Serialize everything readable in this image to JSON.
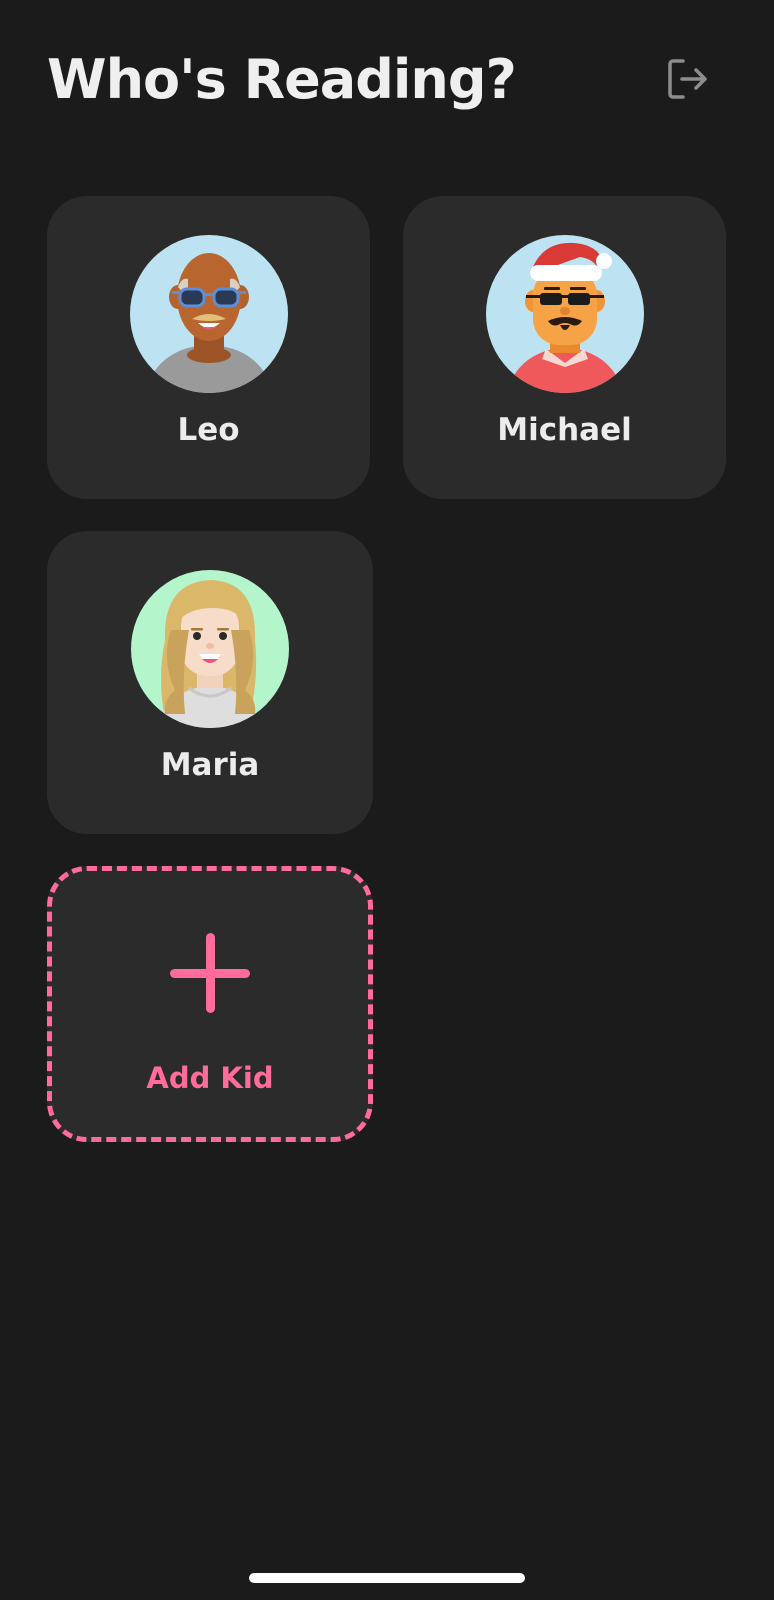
{
  "header": {
    "title": "Who's Reading?",
    "logout_icon": "logout-icon"
  },
  "profiles": [
    {
      "name": "Leo",
      "avatar_icon": "avatar-leo",
      "avatar_bg": "#bde3f3"
    },
    {
      "name": "Michael",
      "avatar_icon": "avatar-michael",
      "avatar_bg": "#bde3f3"
    },
    {
      "name": "Maria",
      "avatar_icon": "avatar-maria",
      "avatar_bg": "#b5f5cc"
    }
  ],
  "add_kid": {
    "label": "Add Kid",
    "icon": "plus-icon"
  },
  "colors": {
    "background": "#1b1b1b",
    "card": "#2b2b2c",
    "accent": "#ff6b9a",
    "text": "#ececec"
  }
}
